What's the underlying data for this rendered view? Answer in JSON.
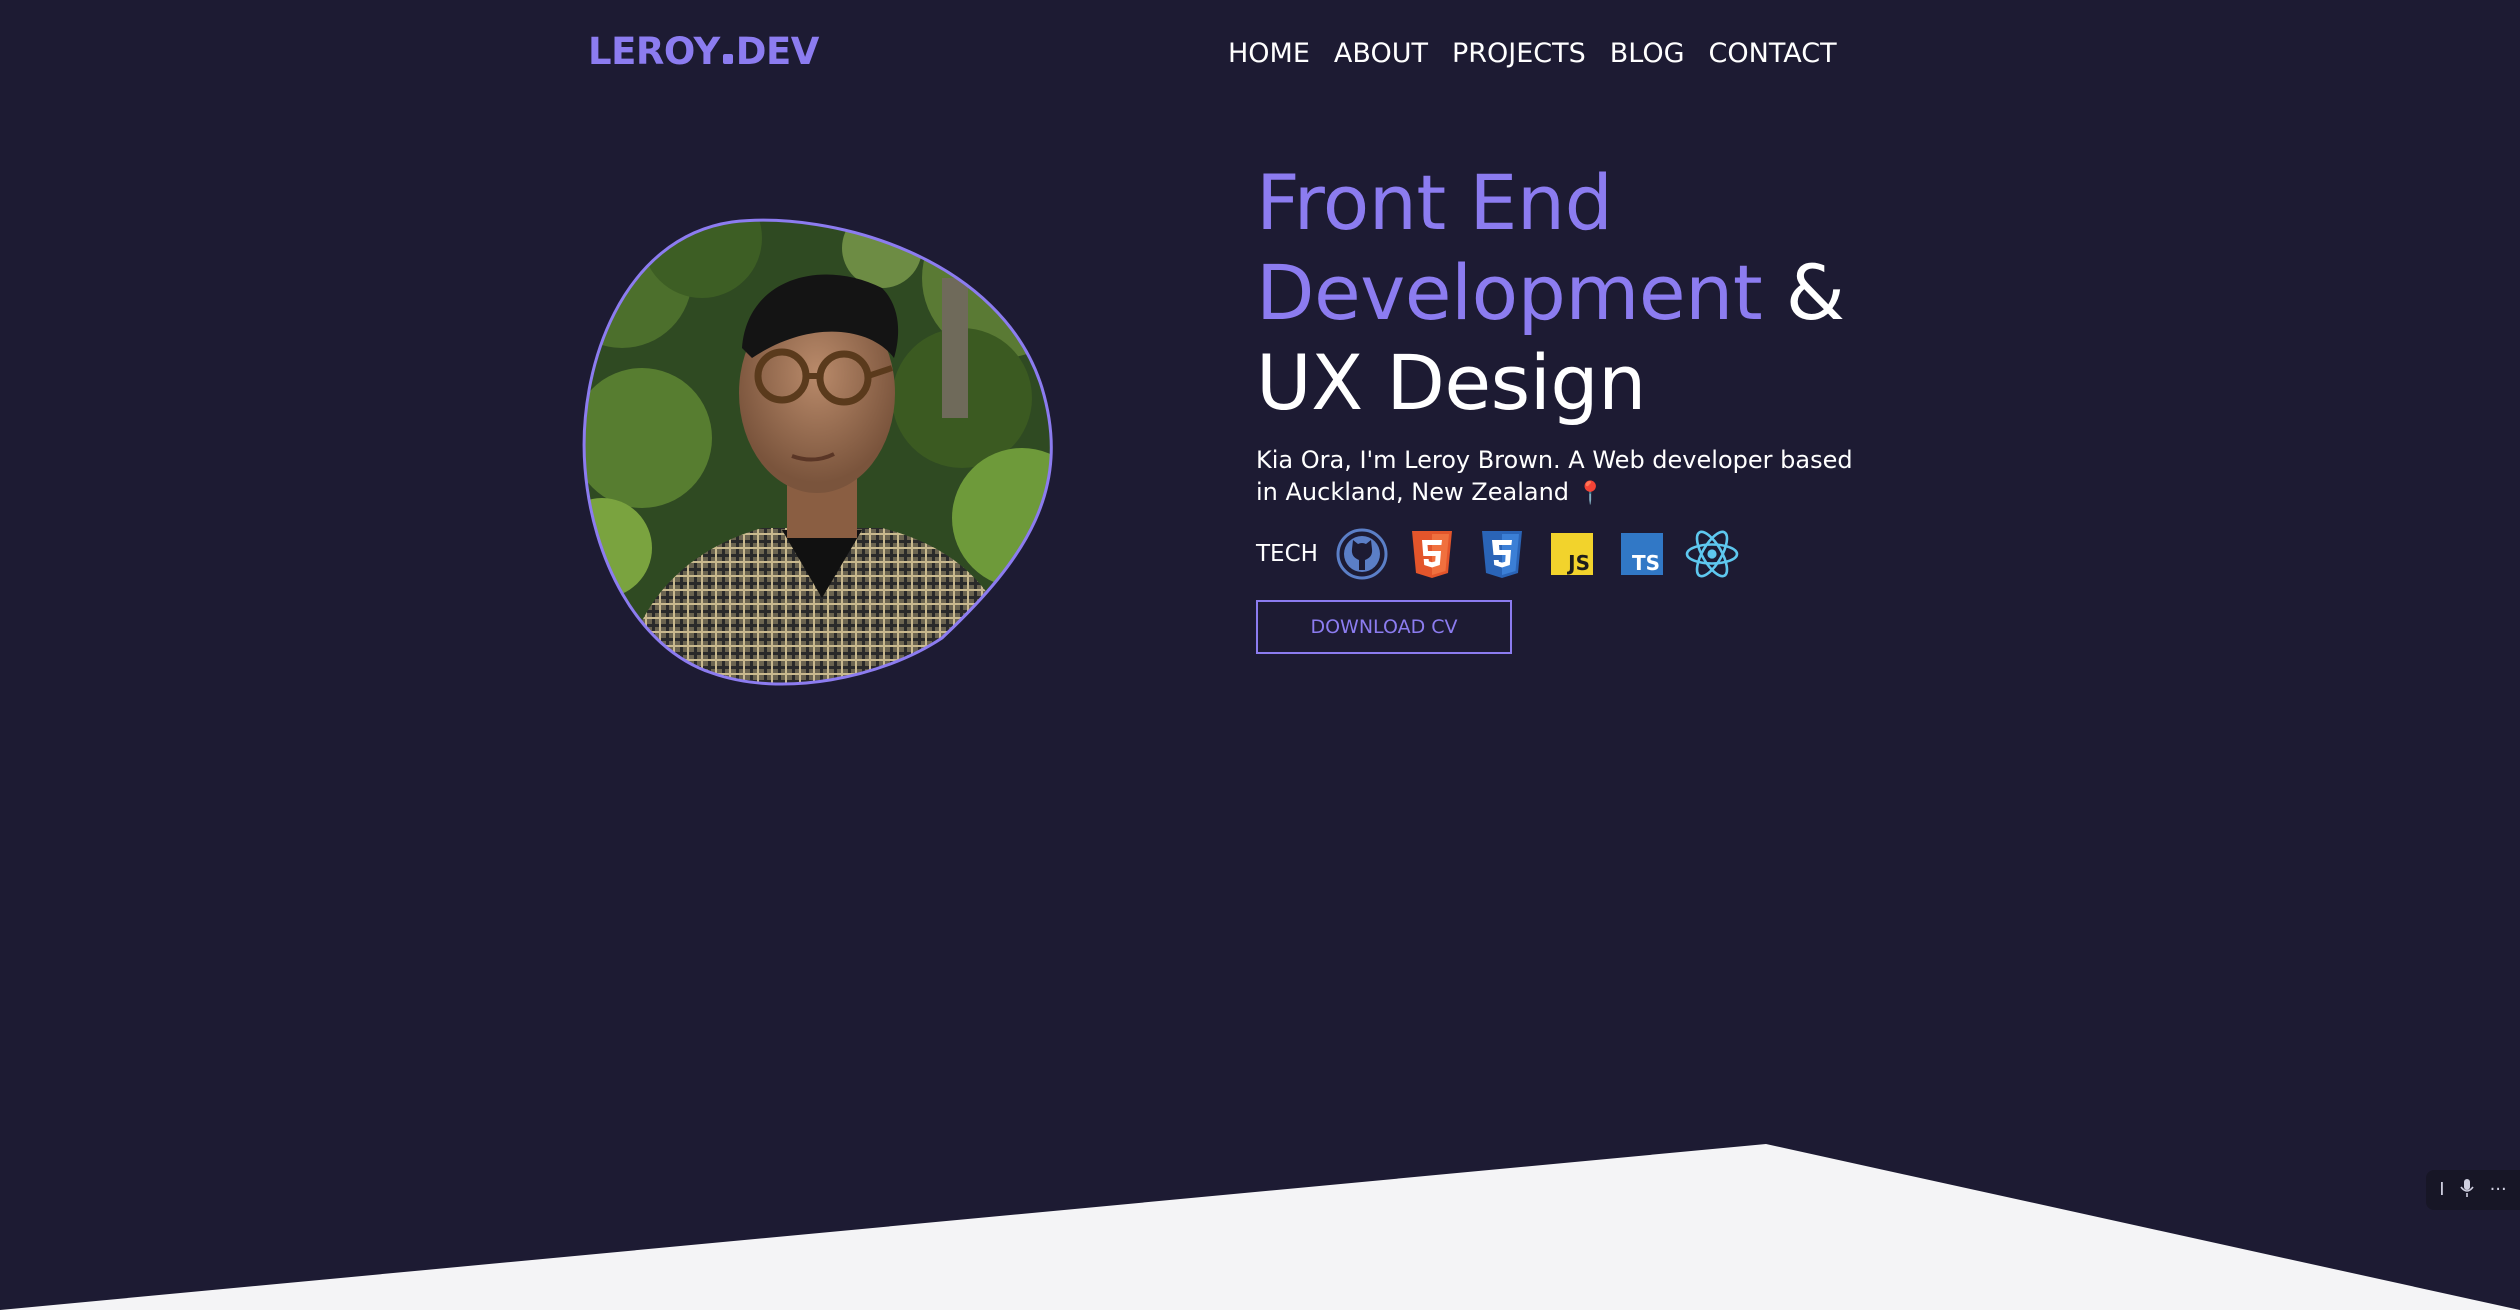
{
  "header": {
    "logo_left": "LEROY",
    "logo_right": "DEV",
    "nav": [
      "HOME",
      "ABOUT",
      "PROJECTS",
      "BLOG",
      "CONTACT"
    ]
  },
  "portrait": {
    "alt": "Portrait of Leroy Brown"
  },
  "hero": {
    "line1": "Front End",
    "line2_accent": "Development",
    "line2_rest": " &",
    "line3": "UX Design",
    "intro": "Kia Ora, I'm Leroy Brown. A Web developer based in Auckland, New Zealand",
    "pin_icon": "location-pin-icon",
    "tech_label": "TECH",
    "tech_icons": [
      "github-icon",
      "html5-icon",
      "css3-icon",
      "javascript-icon",
      "typescript-icon",
      "react-icon"
    ],
    "cta": "DOWNLOAD CV"
  },
  "colors": {
    "background": "#1d1b33",
    "accent": "#8c7cf0",
    "wedge": "#f4f4f6"
  },
  "widget": {
    "icons": [
      "cursor-icon",
      "microphone-icon",
      "more-icon"
    ],
    "more_text": "···"
  }
}
